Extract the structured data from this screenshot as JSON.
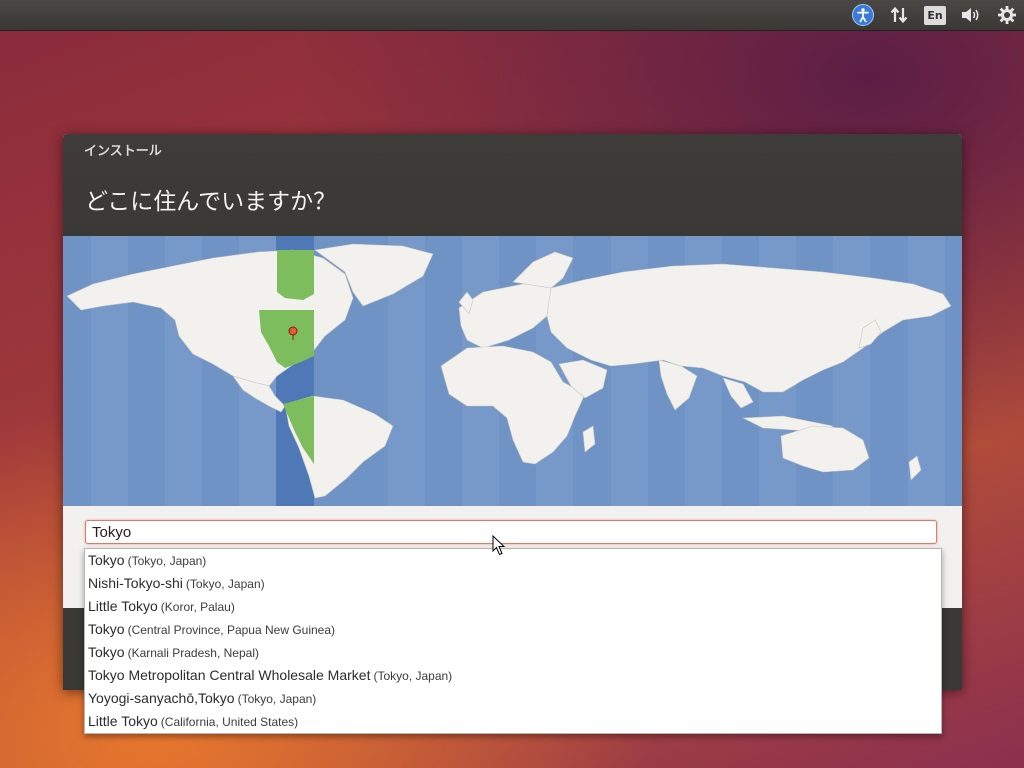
{
  "top_panel": {
    "indicators": [
      {
        "name": "accessibility-icon"
      },
      {
        "name": "network-icon"
      },
      {
        "name": "keyboard-layout-icon",
        "label": "En"
      },
      {
        "name": "volume-icon"
      },
      {
        "name": "power-gear-icon"
      }
    ]
  },
  "window": {
    "title": "インストール",
    "heading": "どこに住んでいますか？"
  },
  "search": {
    "value": "Tokyo"
  },
  "dropdown": {
    "items": [
      {
        "name": "Tokyo",
        "context": "(Tokyo, Japan)"
      },
      {
        "name": "Nishi-Tokyo-shi",
        "context": "(Tokyo, Japan)"
      },
      {
        "name": "Little Tokyo",
        "context": "(Koror, Palau)"
      },
      {
        "name": "Tokyo",
        "context": "(Central Province, Papua New Guinea)"
      },
      {
        "name": "Tokyo",
        "context": "(Karnali Pradesh, Nepal)"
      },
      {
        "name": "Tokyo Metropolitan Central Wholesale Market",
        "context": "(Tokyo, Japan)"
      },
      {
        "name": "Yoyogi-sanyachō,Tokyo",
        "context": "(Tokyo, Japan)"
      },
      {
        "name": "Little Tokyo",
        "context": "(California, United States)"
      }
    ]
  },
  "colors": {
    "ocean": "#6f93c5",
    "land": "#f2f1ee",
    "timezone_highlight": "#7dbd5e",
    "timezone_band": "#4f78b6",
    "accent": "#e07a62"
  }
}
